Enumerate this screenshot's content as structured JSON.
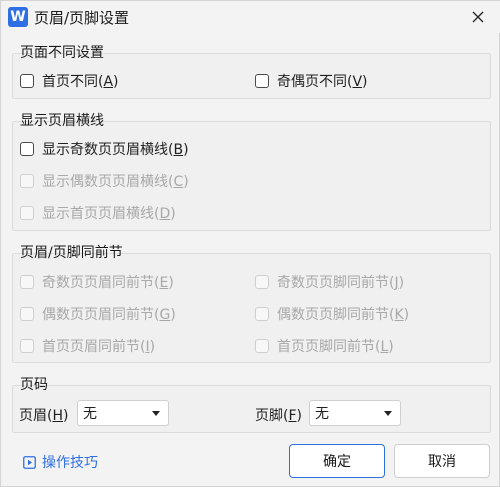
{
  "window": {
    "title": "页眉/页脚设置",
    "app_icon_letter": "W"
  },
  "different_pages": {
    "title": "页面不同设置",
    "first_page": {
      "label": "首页不同(",
      "mnemonic": "A",
      "suffix": ")"
    },
    "odd_even": {
      "label": "奇偶页不同(",
      "mnemonic": "V",
      "suffix": ")"
    }
  },
  "header_line": {
    "title": "显示页眉横线",
    "odd": {
      "label": "显示奇数页页眉横线(",
      "mnemonic": "B",
      "suffix": ")"
    },
    "even": {
      "label": "显示偶数页页眉横线(",
      "mnemonic": "C",
      "suffix": ")"
    },
    "first": {
      "label": "显示首页页眉横线(",
      "mnemonic": "D",
      "suffix": ")"
    }
  },
  "link_previous": {
    "title": "页眉/页脚同前节",
    "odd_header": {
      "label": "奇数页页眉同前节(",
      "mnemonic": "E",
      "suffix": ")"
    },
    "odd_footer": {
      "label": "奇数页页脚同前节(",
      "mnemonic": "J",
      "suffix": ")"
    },
    "even_header": {
      "label": "偶数页页眉同前节(",
      "mnemonic": "G",
      "suffix": ")"
    },
    "even_footer": {
      "label": "偶数页页脚同前节(",
      "mnemonic": "K",
      "suffix": ")"
    },
    "first_header": {
      "label": "首页页眉同前节(",
      "mnemonic": "I",
      "suffix": ")"
    },
    "first_footer": {
      "label": "首页页脚同前节(",
      "mnemonic": "L",
      "suffix": ")"
    }
  },
  "page_number": {
    "title": "页码",
    "header": {
      "label": "页眉(",
      "mnemonic": "H",
      "suffix": ")",
      "value": "无"
    },
    "footer": {
      "label": "页脚(",
      "mnemonic": "F",
      "suffix": ")",
      "value": "无"
    }
  },
  "footer": {
    "tips_label": "操作技巧",
    "ok_label": "确定",
    "cancel_label": "取消"
  },
  "colors": {
    "accent": "#2f6fe4",
    "disabled_text": "#a8a8a8"
  }
}
